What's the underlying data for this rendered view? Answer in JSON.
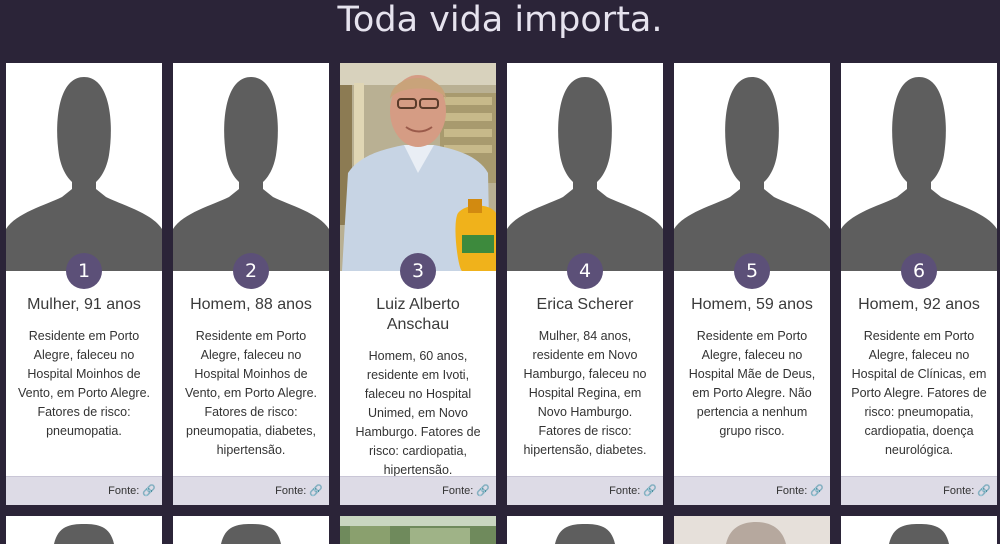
{
  "header": {
    "title": "Toda vida importa."
  },
  "colors": {
    "background": "#2b2438",
    "badge": "#5c5078",
    "footer": "#dddbe6",
    "silhouette": "#5e5e5e"
  },
  "cards": [
    {
      "number": "1",
      "name": "Mulher, 91 anos",
      "description": "Residente em Porto Alegre, faleceu no Hospital Moinhos de Vento, em Porto Alegre. Fatores de risco: pneumopatia.",
      "source_label": "Fonte:",
      "source_icon": "link-icon",
      "photo": "silhouette"
    },
    {
      "number": "2",
      "name": "Homem, 88 anos",
      "description": "Residente em Porto Alegre, faleceu no Hospital Moinhos de Vento, em Porto Alegre. Fatores de risco: pneumopatia, diabetes, hipertensão.",
      "source_label": "Fonte:",
      "source_icon": "link-icon",
      "photo": "silhouette"
    },
    {
      "number": "3",
      "name": "Luiz Alberto Anschau",
      "description": "Homem, 60 anos, residente em Ivoti, faleceu no Hospital Unimed, em Novo Hamburgo. Fatores de risco: cardiopatia, hipertensão.",
      "source_label": "Fonte:",
      "source_icon": "link-icon",
      "photo": "portrait"
    },
    {
      "number": "4",
      "name": "Erica Scherer",
      "description": "Mulher, 84 anos, residente em Novo Hamburgo, faleceu no Hospital Regina, em Novo Hamburgo. Fatores de risco: hipertensão, diabetes.",
      "source_label": "Fonte:",
      "source_icon": "link-icon",
      "photo": "silhouette"
    },
    {
      "number": "5",
      "name": "Homem, 59 anos",
      "description": "Residente em Porto Alegre, faleceu no Hospital Mãe de Deus, em Porto Alegre. Não pertencia a nenhum grupo risco.",
      "source_label": "Fonte:",
      "source_icon": "link-icon",
      "photo": "silhouette"
    },
    {
      "number": "6",
      "name": "Homem, 92 anos",
      "description": "Residente em Porto Alegre, faleceu no Hospital de Clínicas, em Porto Alegre. Fatores de risco: pneumopatia, cardiopatia, doença neurológica.",
      "source_label": "Fonte:",
      "source_icon": "link-icon",
      "photo": "silhouette"
    }
  ]
}
